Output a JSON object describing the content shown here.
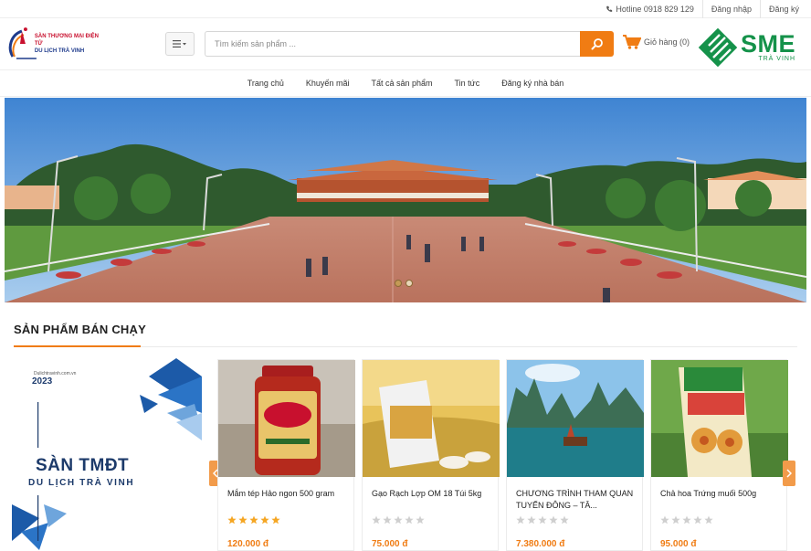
{
  "topbar": {
    "hotline": "Hotline 0918 829 129",
    "login": "Đăng nhập",
    "register": "Đăng ký"
  },
  "header": {
    "logo_line1": "SÀN THƯƠNG MẠI ĐIỆN TỬ",
    "logo_line2": "DU LỊCH TRÀ VINH",
    "search_placeholder": "Tìm kiếm sản phẩm ...",
    "cart_label": "Giỏ hàng (0)",
    "brand_big": "SME",
    "brand_small": "TRÀ VINH"
  },
  "nav": {
    "items": [
      "Trang chủ",
      "Khuyến mãi",
      "Tất cả sản phẩm",
      "Tin tức",
      "Đăng ký nhà bán"
    ]
  },
  "banner": {
    "slide_count": 2,
    "active_slide": 1
  },
  "products_section": {
    "title": "SẢN PHẨM BÁN CHẠY",
    "promo": {
      "site": "Dulichtravinh.com.vn",
      "year": "2023",
      "title": "SÀN TMĐT",
      "subtitle": "DU LỊCH TRÀ VINH"
    },
    "items": [
      {
        "name": "Mắm tép Hảo ngon 500 gram",
        "price": "120.000 đ",
        "rating": 5
      },
      {
        "name": "Gạo Rạch Lợp OM 18 Túi 5kg",
        "price": "75.000 đ",
        "rating": 0
      },
      {
        "name": "CHƯƠNG TRÌNH THAM QUAN TUYẾN ĐÔNG – TÂ...",
        "price": "7.380.000 đ",
        "rating": 0
      },
      {
        "name": "Chả hoa Trứng muối 500g",
        "price": "95.000 đ",
        "rating": 0
      }
    ]
  },
  "colors": {
    "accent": "#f07c13",
    "brand_green": "#15924a",
    "star_filled": "#f5a623",
    "star_empty": "#cfcfcf"
  }
}
